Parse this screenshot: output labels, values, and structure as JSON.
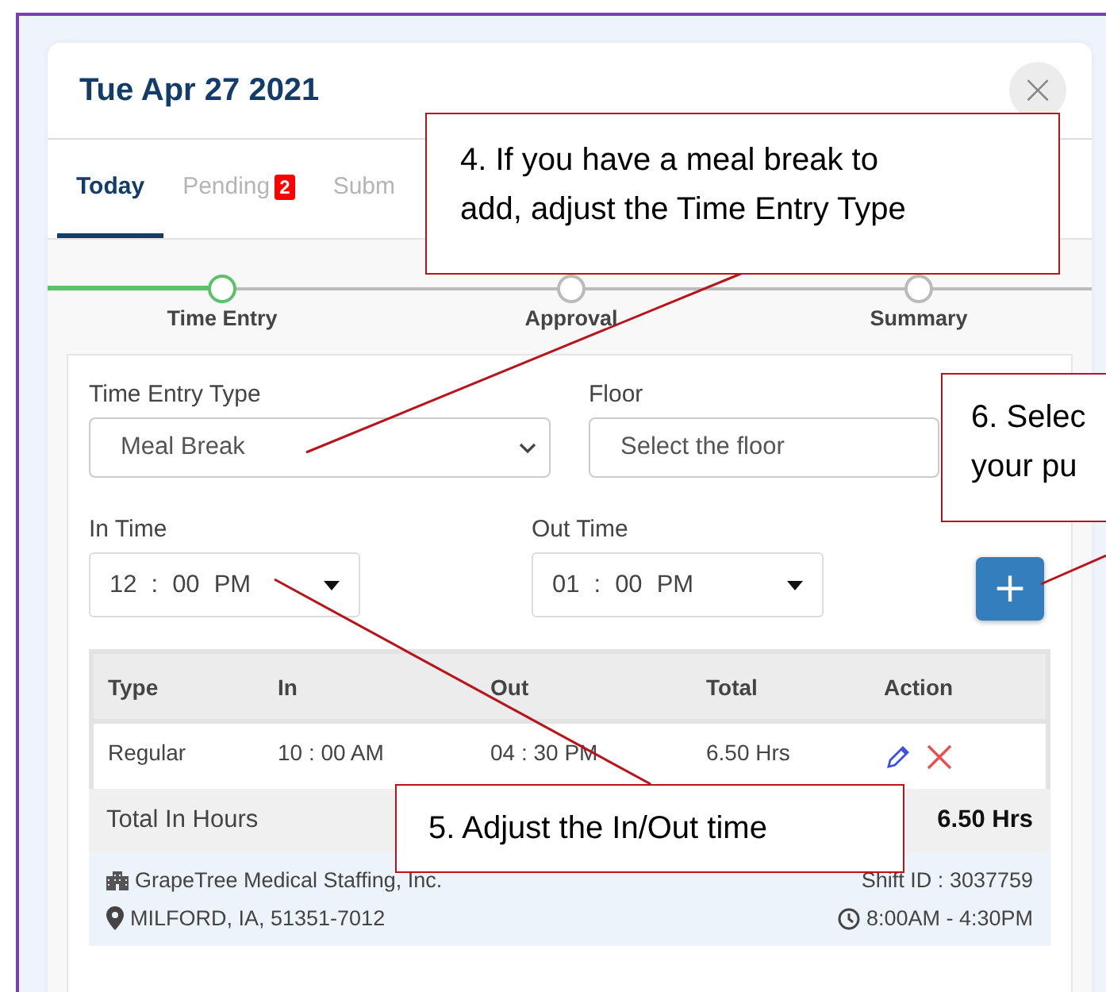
{
  "dialog": {
    "title": "Tue Apr 27 2021",
    "close": "×"
  },
  "tabs": [
    {
      "label": "Today",
      "selected": true
    },
    {
      "label": "Pending",
      "badge": "2",
      "selected": false
    },
    {
      "label": "Subm",
      "selected": false
    }
  ],
  "steps": [
    {
      "label": "Time Entry",
      "active": true
    },
    {
      "label": "Approval",
      "active": false
    },
    {
      "label": "Summary",
      "active": false
    }
  ],
  "form": {
    "type_label": "Time Entry Type",
    "type_value": "Meal Break",
    "floor_label": "Floor",
    "floor_placeholder": "Select the floor",
    "separator": ":",
    "in_label": "In Time",
    "in_time": {
      "hour": "12",
      "minute": "00",
      "ampm": "PM"
    },
    "out_label": "Out Time",
    "out_time": {
      "hour": "01",
      "minute": "00",
      "ampm": "PM"
    },
    "add": "+"
  },
  "table": {
    "columns": [
      "Type",
      "In",
      "Out",
      "Total",
      "Action"
    ],
    "rows": [
      {
        "type": "Regular",
        "in": "10 : 00 AM",
        "out": "04 : 30 PM",
        "total": "6.50 Hrs"
      }
    ]
  },
  "total": {
    "label": "Total In Hours",
    "value": "6.50 Hrs"
  },
  "shift": {
    "company": "GrapeTree Medical Staffing, Inc.",
    "location": "MILFORD, IA, 51351-7012",
    "shift_id": "Shift ID : 3037759",
    "hours": "8:00AM - 4:30PM"
  },
  "callouts": [
    {
      "lines": [
        "4. If you have a meal break to",
        "add, adjust the Time Entry Type"
      ]
    },
    {
      "lines": [
        "6. Selec",
        "your pu"
      ]
    },
    {
      "lines": [
        "5. Adjust the In/Out time"
      ]
    }
  ]
}
